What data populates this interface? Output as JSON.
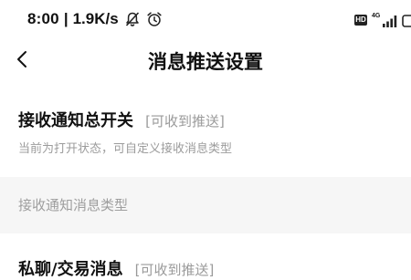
{
  "status_bar": {
    "time": "8:00",
    "separator": "|",
    "net_speed": "1.9K/s",
    "icons": [
      "notifications-off-icon",
      "alarm-icon"
    ],
    "right_icons": [
      "hd-icon",
      "signal-icon",
      "battery-icon"
    ],
    "hd_label": "HD",
    "network_type": "4G"
  },
  "nav": {
    "back_icon": "chevron-left-icon",
    "title": "消息推送设置"
  },
  "settings": {
    "master": {
      "title": "接收通知总开关",
      "status": "[可收到推送]",
      "description": "当前为打开状态，可自定义接收消息类型"
    },
    "section_label": "接收通知消息类型",
    "private_chat": {
      "title": "私聊/交易消息",
      "status": "[可收到推送]"
    }
  }
}
